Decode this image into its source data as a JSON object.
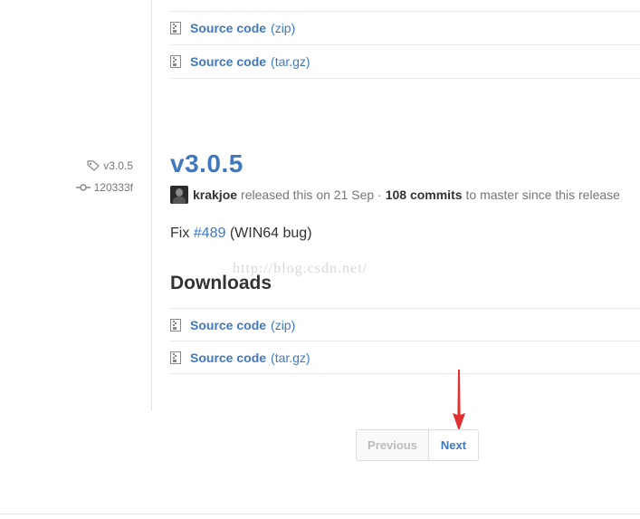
{
  "top_downloads": [
    {
      "name": "Source code",
      "ext": "(zip)"
    },
    {
      "name": "Source code",
      "ext": "(tar.gz)"
    }
  ],
  "release": {
    "tag": "v3.0.5",
    "commit": "120333f",
    "title": "v3.0.5",
    "author": "krakjoe",
    "released_text": "released this on 21 Sep ·",
    "commits_count": "108 commits",
    "commits_suffix": "to master since this release",
    "desc_prefix": "Fix",
    "issue_link": "#489",
    "desc_suffix": "(WIN64 bug)"
  },
  "downloads_heading": "Downloads",
  "downloads": [
    {
      "name": "Source code",
      "ext": "(zip)"
    },
    {
      "name": "Source code",
      "ext": "(tar.gz)"
    }
  ],
  "watermark": "http://blog.csdn.net/",
  "pagination": {
    "previous": "Previous",
    "next": "Next"
  },
  "colors": {
    "link": "#4078c0",
    "arrow": "#e03030"
  }
}
